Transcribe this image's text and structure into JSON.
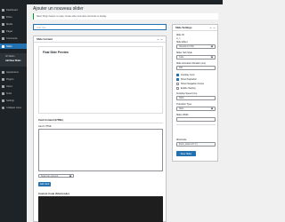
{
  "nav": {
    "items": [
      {
        "label": "Dashboard"
      },
      {
        "label": "Posts"
      },
      {
        "label": "Media"
      },
      {
        "label": "Pages"
      },
      {
        "label": "Comments"
      },
      {
        "label": "Slider"
      },
      {
        "label": "Appearance"
      },
      {
        "label": "Plugins"
      },
      {
        "label": "Users"
      },
      {
        "label": "Tools"
      },
      {
        "label": "Settings"
      },
      {
        "label": "Collapse menu"
      }
    ],
    "submenu": {
      "items": [
        {
          "label": "All Sliders"
        },
        {
          "label": "Add New Slider"
        }
      ]
    }
  },
  "page": {
    "title": "Ajouter un nouveau slider",
    "notice": "Slider Plugin feature is ready. Create slider and paste shortcode to display."
  },
  "editor": {
    "title_placeholder": "Add title"
  },
  "slide_content": {
    "header": "Slide Content",
    "preview_title": "Final Slide Preview",
    "card_content_header": "Card Content (HTML)",
    "card_label": "Card 1 HTML",
    "select_placeholder": "Select an element",
    "add_button": "Add Card"
  },
  "custom_code": {
    "header": "Custom Code (Shortcode)"
  },
  "settings": {
    "header": "Slide Settings",
    "slide_id_label": "Slide ID",
    "slide_id_value": "sl_1",
    "type_label": "Slide Effect",
    "type_value": "Standard (CSS)",
    "slide_style_label": "Slider Sub Style",
    "slide_style_value": "Fade",
    "duration_label": "Slide Animation Duration (ms)",
    "duration_value": "600",
    "options": [
      {
        "label": "Autoplay Loop",
        "checked": true
      },
      {
        "label": "Show Pagination",
        "checked": true
      },
      {
        "label": "Show Navigation Arrows",
        "checked": false
      },
      {
        "label": "Enable Swiping",
        "checked": false
      }
    ],
    "autoplay_label": "Autoplay Speed (ms)",
    "autoplay_value": "3000",
    "transition_label": "Transition Type",
    "transition_value": "Slide",
    "width_label": "Slider Width",
    "width_value": "",
    "shortcode_label": "Shortcode",
    "shortcode_value": "[bpcs_slider id=\"1\"]",
    "publish_button": "Save Slider"
  },
  "colors": {
    "sidebar_bg": "#1d2327",
    "accent": "#2271b1",
    "notice_border": "#00a32a",
    "page_bg": "#f0f0f1",
    "code_bg": "#1e1e1e"
  }
}
